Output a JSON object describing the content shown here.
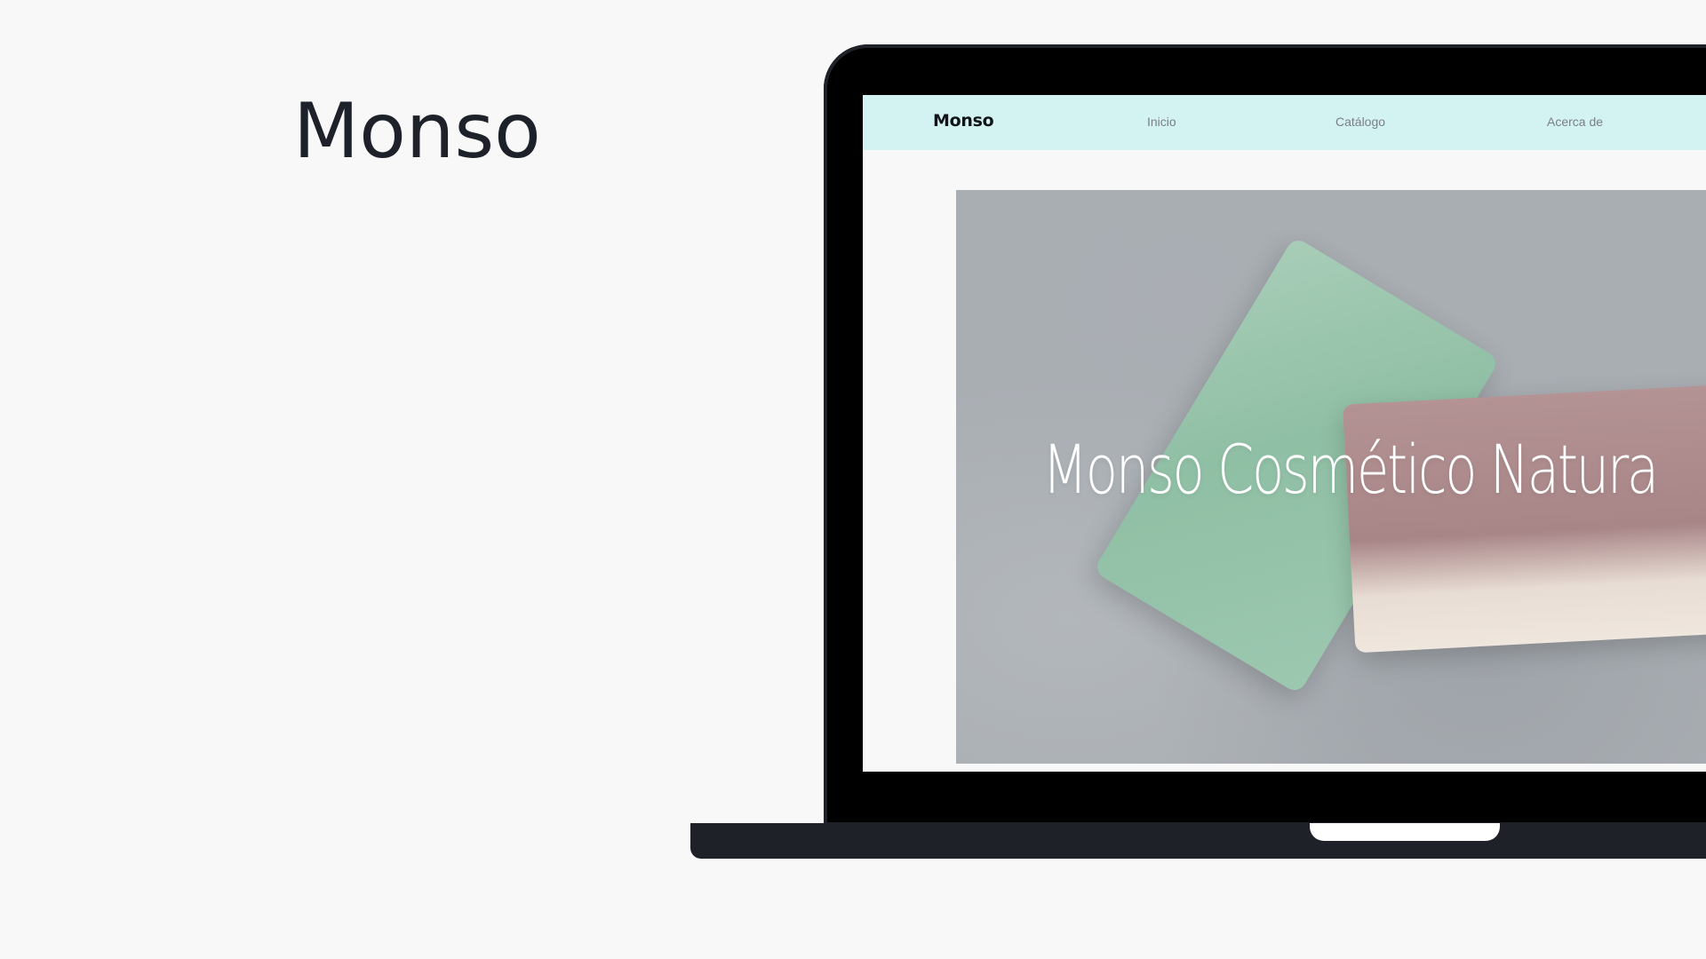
{
  "heading": "Monso",
  "website": {
    "brand": "Monso",
    "nav": [
      {
        "label": "Inicio"
      },
      {
        "label": "Catálogo"
      },
      {
        "label": "Acerca de"
      }
    ],
    "hero": {
      "title": "Monso Cosmético Natura",
      "image": "soap-bars-on-concrete"
    }
  },
  "colors": {
    "page_background": "#f8f8f8",
    "nav_background": "#d3f2f2",
    "laptop_frame": "#000000",
    "laptop_base": "#1e2128"
  }
}
